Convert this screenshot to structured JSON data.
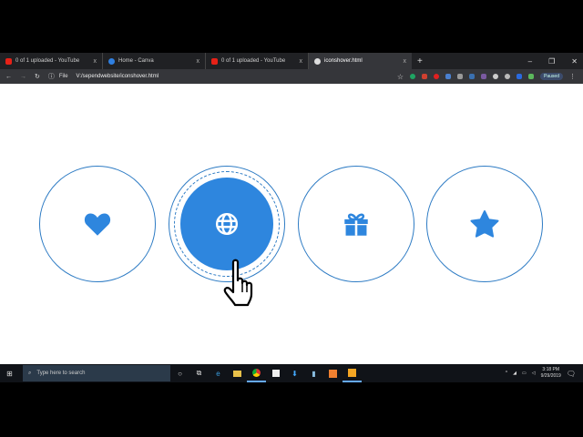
{
  "browser": {
    "tabs": [
      {
        "title": "0 of 1 uploaded - YouTube",
        "icon": "youtube-icon",
        "color": "#e62117"
      },
      {
        "title": "Home - Canva",
        "icon": "canva-icon",
        "color": "#2f7fe0"
      },
      {
        "title": "0 of 1 uploaded - YouTube",
        "icon": "youtube-icon",
        "color": "#e62117"
      },
      {
        "title": "iconshover.html",
        "icon": "globe-icon",
        "color": "#ddd",
        "active": true
      }
    ],
    "close": "x",
    "new_tab": "+",
    "window_controls": {
      "minimize": "–",
      "maximize": "❐",
      "close": "✕"
    },
    "address": {
      "info": "ⓘ",
      "scheme": "File",
      "url": "V:/sependwebsite/iconshover.html"
    },
    "profile_status": "Paused"
  },
  "page": {
    "icons": [
      {
        "name": "heart",
        "state": "normal"
      },
      {
        "name": "globe",
        "state": "hover"
      },
      {
        "name": "gift",
        "state": "normal"
      },
      {
        "name": "star",
        "state": "normal"
      }
    ],
    "accent": "#2e86de"
  },
  "taskbar": {
    "search_placeholder": "Type here to search",
    "time": "3:18 PM",
    "date": "9/29/2019"
  }
}
